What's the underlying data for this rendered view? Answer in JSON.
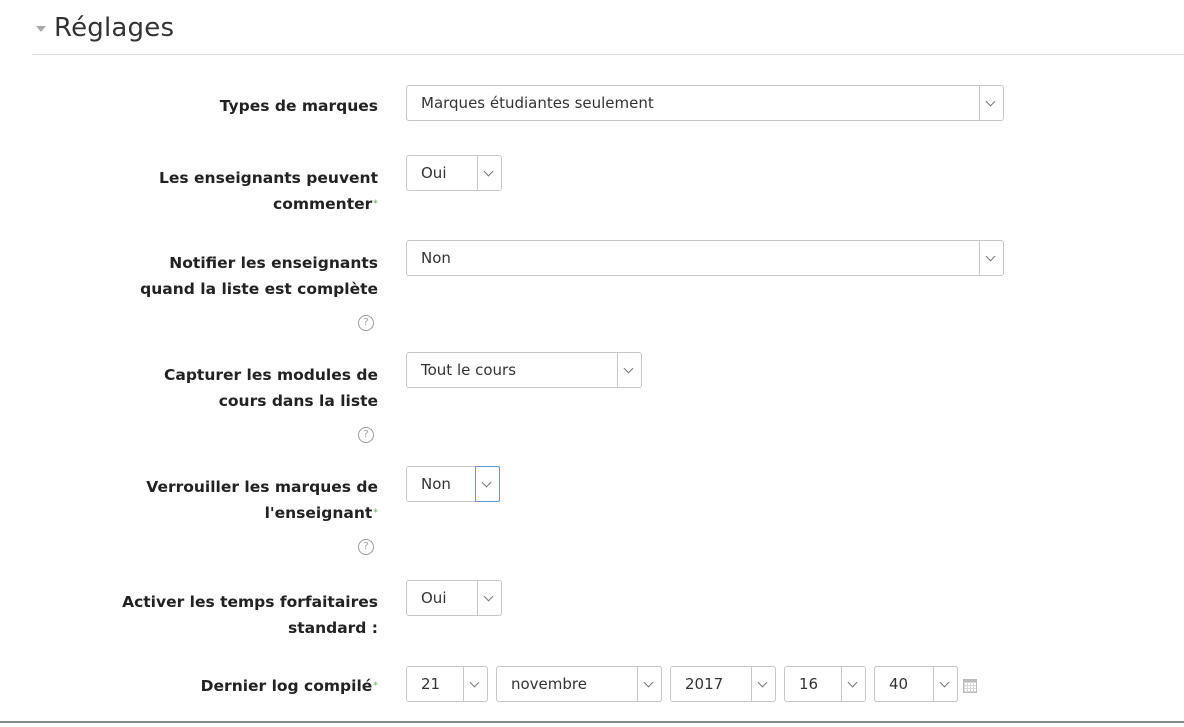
{
  "section": {
    "title": "Réglages"
  },
  "fields": {
    "mark_types": {
      "label": "Types de marques",
      "value": "Marques étudiantes seulement"
    },
    "teachers_comment": {
      "label_line1": "Les enseignants peuvent",
      "label_line2": "commenter",
      "required_marker": "*",
      "value": "Oui"
    },
    "notify_teachers": {
      "label_line1": "Notifier les enseignants",
      "label_line2": "quand la liste est complète",
      "value": "Non"
    },
    "capture_modules": {
      "label_line1": "Capturer les modules de",
      "label_line2": "cours dans la liste",
      "value": "Tout le cours"
    },
    "lock_teacher_marks": {
      "label_line1": "Verrouiller les marques de",
      "label_line2": "l'enseignant",
      "required_marker": "*",
      "value": "Non"
    },
    "standard_times": {
      "label_line1": "Activer les temps forfaitaires",
      "label_line2": "standard :",
      "value": "Oui"
    },
    "last_log": {
      "label": "Dernier log compilé",
      "required_marker": "*",
      "day": "21",
      "month": "novembre",
      "year": "2017",
      "hour": "16",
      "minute": "40"
    }
  },
  "help_icon_glyph": "?",
  "colors": {
    "focus_border": "#5b9bd5",
    "required_marker": "#7fbf7f"
  }
}
